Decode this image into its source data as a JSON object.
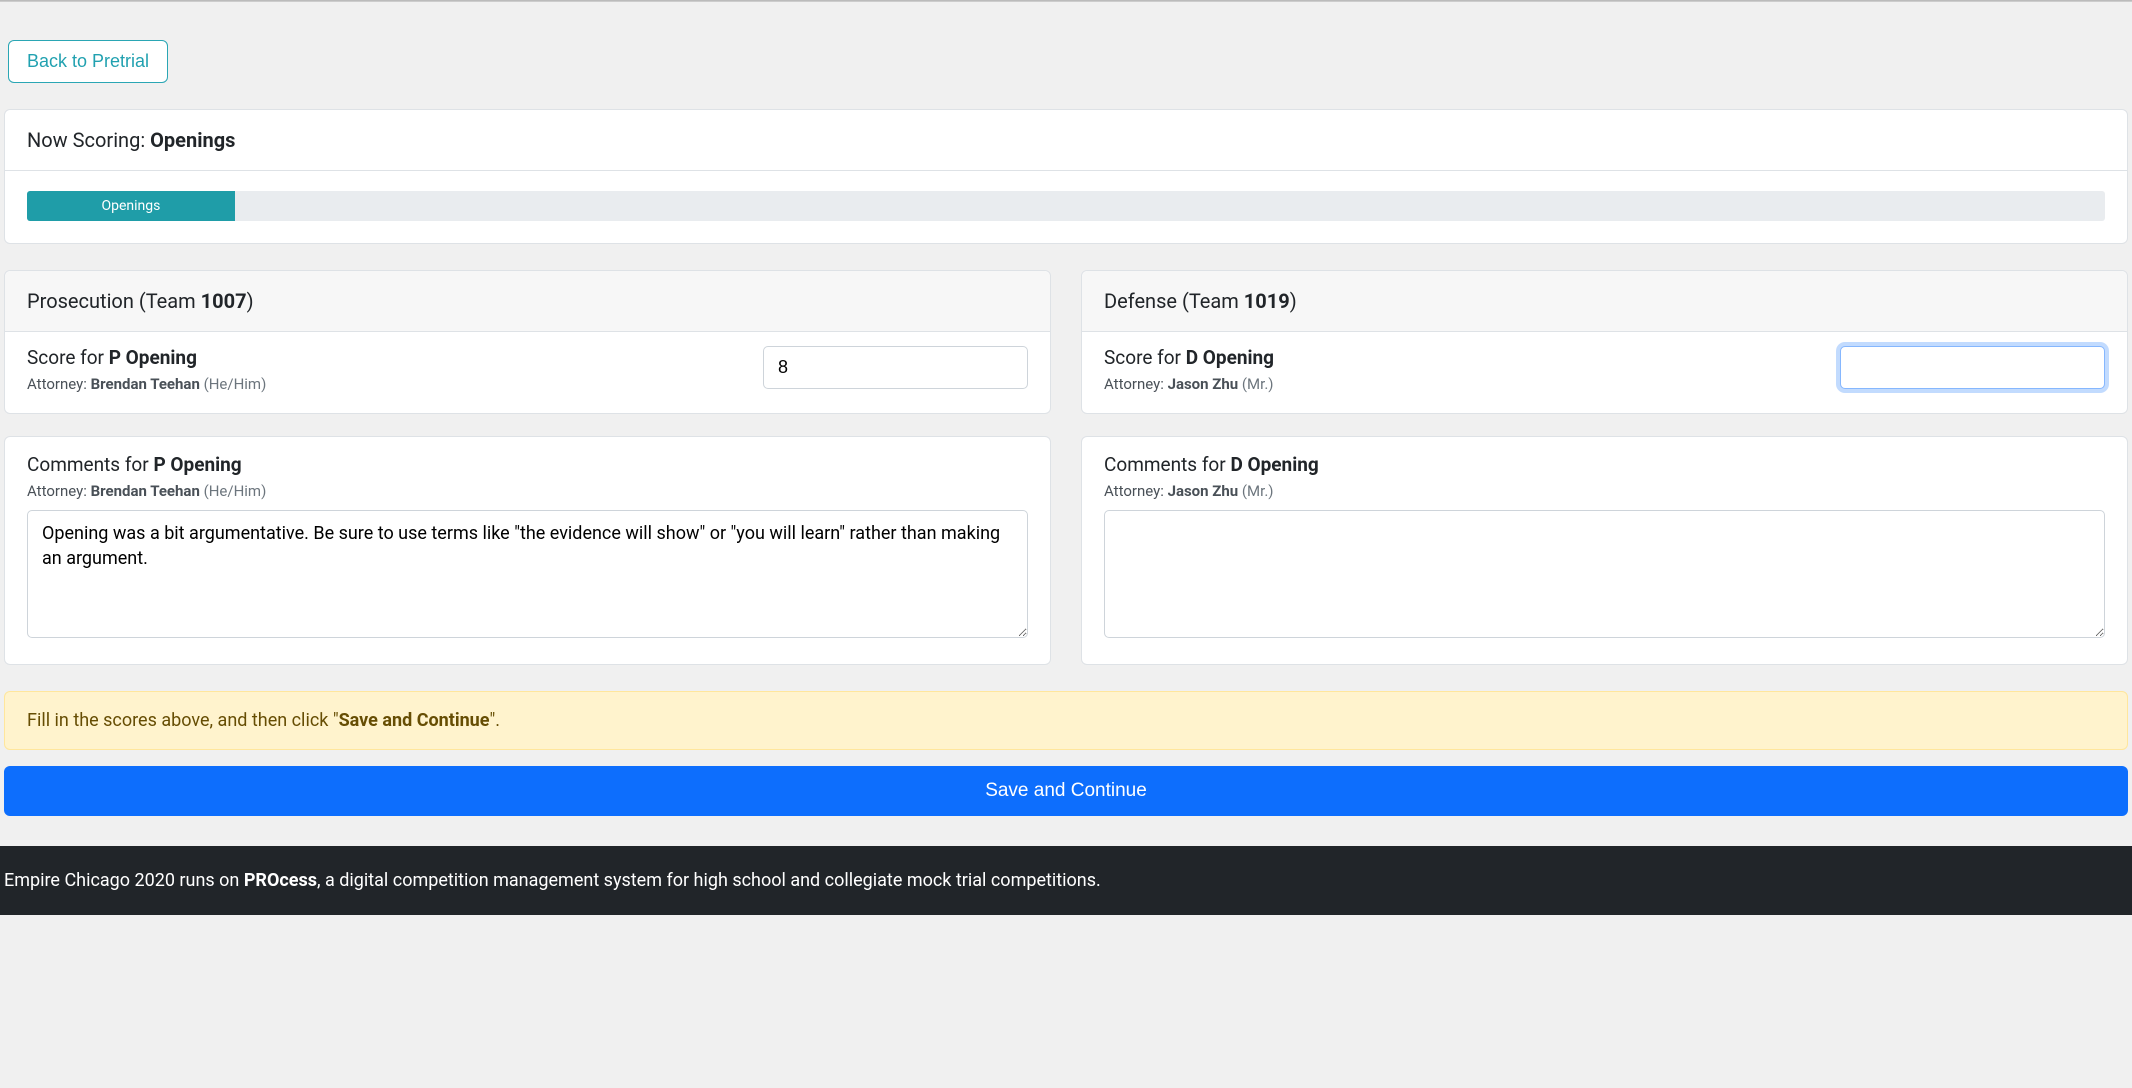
{
  "nav": {
    "back_label": "Back to Pretrial"
  },
  "scoring": {
    "now_scoring_prefix": "Now Scoring: ",
    "now_scoring_section": "Openings",
    "progress_segment_label": "Openings"
  },
  "prosecution": {
    "header_prefix": "Prosecution (Team ",
    "team_number": "1007",
    "header_suffix": ")",
    "score_label_prefix": "Score for ",
    "score_label_bold": "P Opening",
    "attorney_label": "Attorney: ",
    "attorney_name": "Brendan Teehan",
    "attorney_pronouns": " (He/Him)",
    "score_value": "8",
    "comments_label_prefix": "Comments for ",
    "comments_label_bold": "P Opening",
    "comments_value": "Opening was a bit argumentative. Be sure to use terms like \"the evidence will show\" or \"you will learn\" rather than making an argument."
  },
  "defense": {
    "header_prefix": "Defense (Team ",
    "team_number": "1019",
    "header_suffix": ")",
    "score_label_prefix": "Score for ",
    "score_label_bold": "D Opening",
    "attorney_label": "Attorney: ",
    "attorney_name": "Jason Zhu",
    "attorney_pronouns": " (Mr.)",
    "score_value": "",
    "comments_label_prefix": "Comments for ",
    "comments_label_bold": "D Opening",
    "comments_value": ""
  },
  "alert": {
    "text_before": "Fill in the scores above, and then click \"",
    "text_bold": "Save and Continue",
    "text_after": "\"."
  },
  "actions": {
    "save_label": "Save and Continue"
  },
  "footer": {
    "text_before": "Empire Chicago 2020 runs on ",
    "text_bold": "PROcess",
    "text_after": ", a digital competition management system for high school and collegiate mock trial competitions."
  }
}
